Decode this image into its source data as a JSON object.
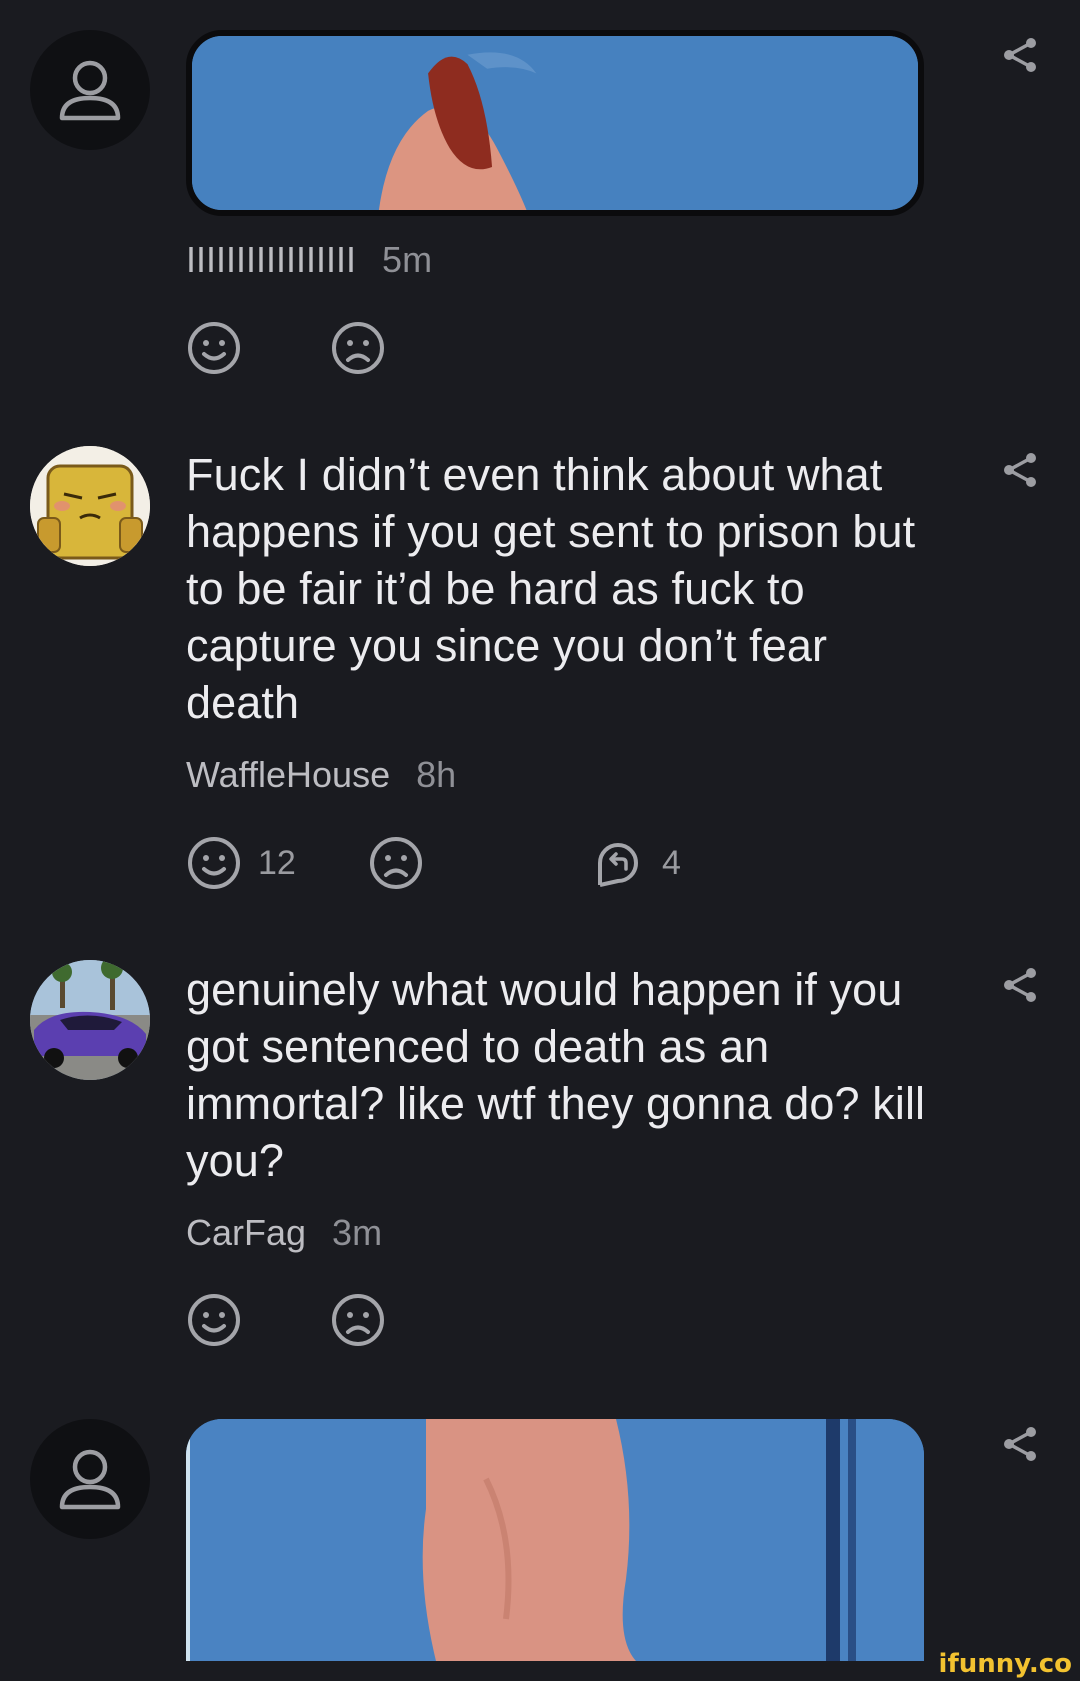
{
  "comments": [
    {
      "username": "IIIIIIIIIIIIIIIII",
      "time": "5m",
      "avatar_icon": "default-user-icon",
      "media": "image"
    },
    {
      "username": "WaffleHouse",
      "time": "8h",
      "avatar_icon": "waffle-character-avatar",
      "text": "Fuck I didn’t even think about what happens if you get sent to prison but to be fair it’d be hard as fuck to capture you since you don’t fear death",
      "smile_count": "12",
      "reply_count": "4"
    },
    {
      "username": "CarFag",
      "time": "3m",
      "avatar_icon": "purple-car-avatar",
      "text": "genuinely what would happen if you got sentenced to death as an immortal? like wtf they gonna do? kill you?"
    },
    {
      "avatar_icon": "default-user-icon",
      "media": "image"
    }
  ],
  "watermark": "ifunny.co",
  "colors": {
    "background": "#1a1b20",
    "text": "#ececef",
    "muted": "#8f9096",
    "icon": "#a4a5aa",
    "media_blue": "#4681bf",
    "watermark": "#f2c230"
  }
}
